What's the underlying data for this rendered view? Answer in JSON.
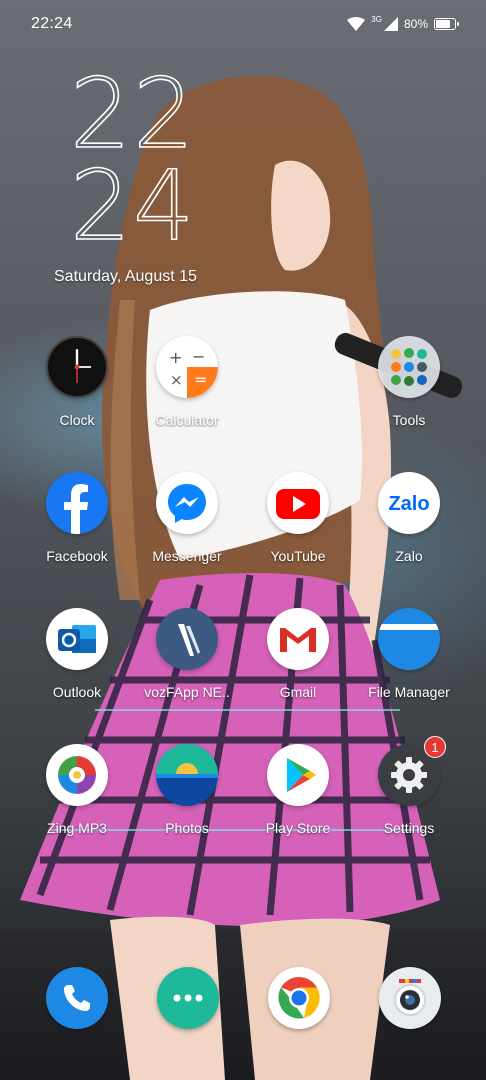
{
  "status_bar": {
    "time": "22:24",
    "network": "3G",
    "battery_percent": "80%",
    "battery_level": 0.8,
    "icons": [
      "wifi-icon",
      "signal-icon",
      "battery-icon"
    ]
  },
  "clock_widget": {
    "hours": "22",
    "minutes": "24",
    "date": "Saturday, August 15"
  },
  "apps": [
    {
      "label": "Clock",
      "icon": "clock-icon"
    },
    {
      "label": "Calculator",
      "icon": "calculator-icon"
    },
    {
      "label": "",
      "icon": ""
    },
    {
      "label": "Tools",
      "icon": "tools-folder-icon"
    },
    {
      "label": "Facebook",
      "icon": "facebook-icon"
    },
    {
      "label": "Messenger",
      "icon": "messenger-icon"
    },
    {
      "label": "YouTube",
      "icon": "youtube-icon"
    },
    {
      "label": "Zalo",
      "icon": "zalo-icon"
    },
    {
      "label": "Outlook",
      "icon": "outlook-icon"
    },
    {
      "label": "vozFApp NE..",
      "icon": "vozfapp-icon"
    },
    {
      "label": "Gmail",
      "icon": "gmail-icon"
    },
    {
      "label": "File Manager",
      "icon": "file-manager-icon"
    },
    {
      "label": "Zing MP3",
      "icon": "zing-mp3-icon"
    },
    {
      "label": "Photos",
      "icon": "photos-icon"
    },
    {
      "label": "Play Store",
      "icon": "play-store-icon"
    },
    {
      "label": "Settings",
      "icon": "settings-icon",
      "badge": "1"
    }
  ],
  "zalo_logo_text": "Zalo",
  "dock": [
    {
      "icon": "phone-icon"
    },
    {
      "icon": "app-drawer-icon"
    },
    {
      "icon": "chrome-icon"
    },
    {
      "icon": "camera-icon"
    }
  ],
  "colors": {
    "facebook": "#1877f2",
    "messenger_blue": "#0a84ff",
    "youtube": "#ff0000",
    "zalo": "#0068ff",
    "outlook": "#0f6cbd",
    "gmail_red": "#d93025",
    "file_manager": "#1e88e5",
    "phone": "#1e88e5",
    "drawer": "#1db99a",
    "badge": "#e53935"
  }
}
